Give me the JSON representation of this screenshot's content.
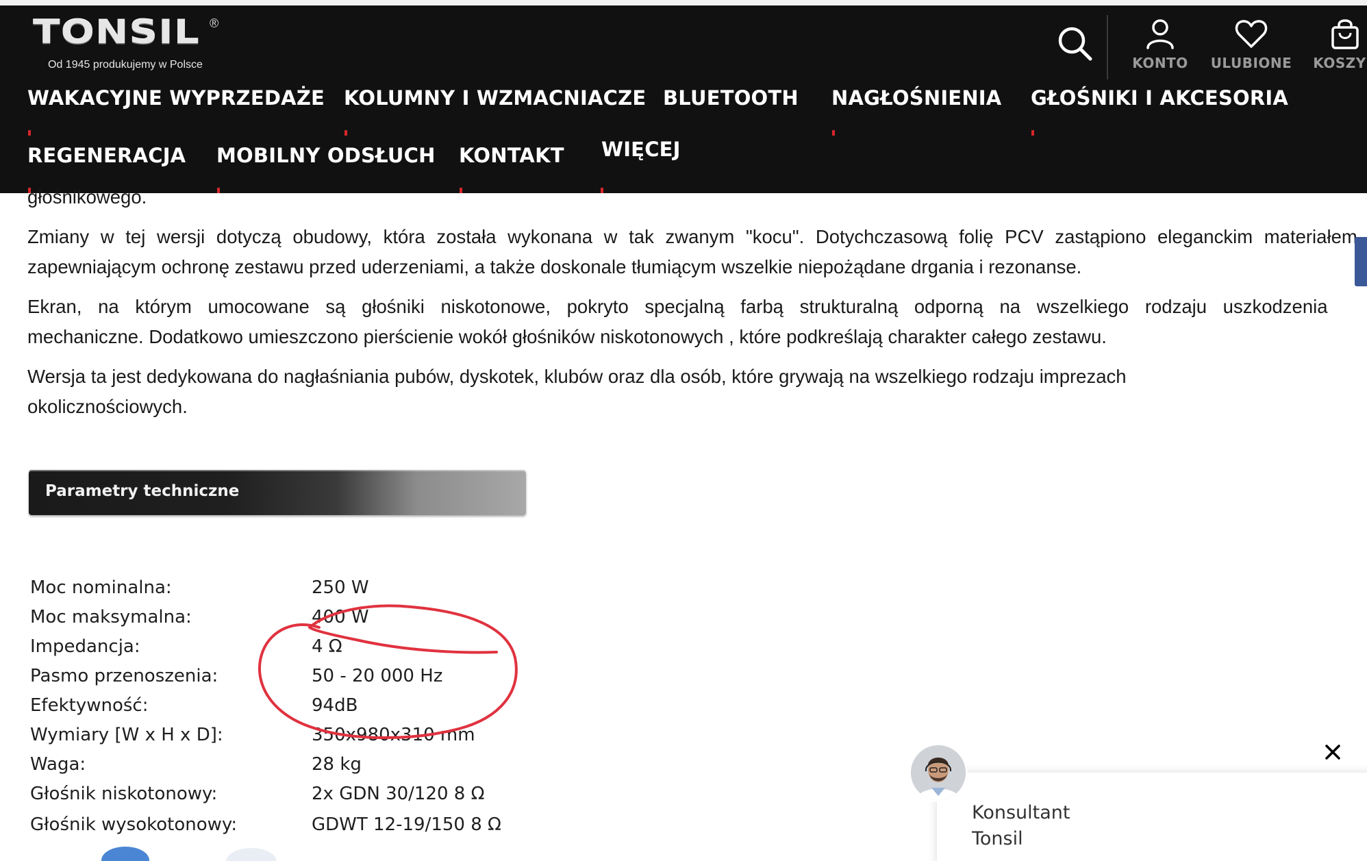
{
  "header": {
    "logo_text": "TONSIL",
    "logo_reg": "®",
    "logo_tagline": "Od 1945 produkujemy w Polsce",
    "account_label": "KONTO",
    "favorites_label": "ULUBIONE",
    "cart_label": "KOSZYK"
  },
  "nav": {
    "row1": [
      "WAKACYJNE WYPRZEDAŻE",
      "KOLUMNY I WZMACNIACZE",
      "BLUETOOTH",
      "NAGŁOŚNIENIA",
      "GŁOŚNIKI I AKCESORIA"
    ],
    "row2": [
      "REGENERACJA",
      "MOBILNY ODSŁUCH",
      "KONTAKT",
      "WIĘCEJ"
    ]
  },
  "content": {
    "clipped_text": "głośnikowego.",
    "p1_line1": "Zmiany w tej wersji dotyczą obudowy, która została wykonana w tak zwanym \"kocu\". Dotychczasową folię PCV zastąpiono eleganckim materiałem,",
    "p1_line2": "zapewniającym ochronę zestawu przed uderzeniami, a także doskonale tłumiącym wszelkie niepożądane drgania i rezonanse.",
    "p2_line1": "Ekran, na którym umocowane są głośniki niskotonowe, pokryto specjalną farbą strukturalną odporną na wszelkiego rodzaju uszkodzenia",
    "p2_line2": "mechaniczne. Dodatkowo  umieszczono pierścienie wokół głośników niskotonowych , które podkreślają charakter całego zestawu.",
    "p3_line1": "Wersja ta jest dedykowana do nagłaśniania pubów, dyskotek, klubów oraz dla osób, które grywają na wszelkiego rodzaju imprezach",
    "p3_line2": "okolicznościowych."
  },
  "params": {
    "heading": "Parametry techniczne",
    "rows": [
      {
        "key": "Moc nominalna:",
        "value": "250 W"
      },
      {
        "key": "Moc maksymalna:",
        "value": "400 W"
      },
      {
        "key": "Impedancja:",
        "value": "4 Ω"
      },
      {
        "key": "Pasmo przenoszenia:",
        "value": "50 - 20 000 Hz"
      },
      {
        "key": "Efektywność:",
        "value": "94dB"
      },
      {
        "key": "Wymiary [W x H x D]:",
        "value": "350x980x310 mm"
      },
      {
        "key": "Waga:",
        "value": "28 kg"
      },
      {
        "key": "Głośnik niskotonowy:",
        "value": "2x GDN 30/120 8 Ω"
      },
      {
        "key": "Głośnik wysokotonowy:",
        "value": "GDWT 12-19/150 8 Ω"
      }
    ]
  },
  "chat": {
    "name_line1": "Konsultant",
    "name_line2": "Tonsil"
  },
  "colors": {
    "header_bg": "#111111",
    "nav_marker": "#d6262b",
    "annotation": "#e0323f",
    "facebook": "#3b5998"
  }
}
